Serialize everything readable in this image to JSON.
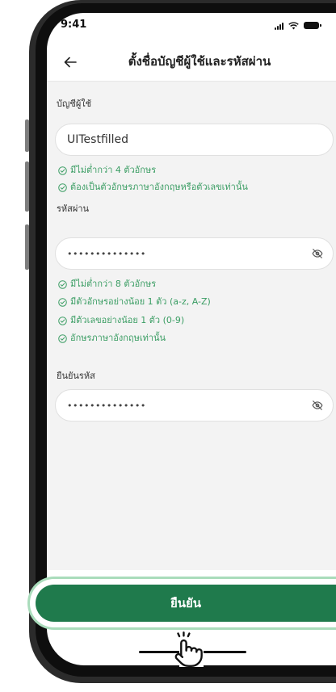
{
  "status_bar": {
    "time": "9:41",
    "icons": [
      "signal-icon",
      "wifi-icon",
      "battery-icon"
    ]
  },
  "header": {
    "back_icon": "arrow-left-icon",
    "title": "ตั้งชื่อบัญชีผู้ใช้และรหัสผ่าน"
  },
  "form": {
    "username": {
      "label": "บัญชีผู้ใช้",
      "value": "UITestfilled",
      "rules": [
        "มีไม่ต่ำกว่า 4 ตัวอักษร",
        "ต้องเป็นตัวอักษรภาษาอังกฤษหรือตัวเลขเท่านั้น"
      ]
    },
    "password": {
      "label": "รหัสผ่าน",
      "value": "••••••••••••••",
      "toggle_icon": "eye-slash-icon",
      "rules": [
        "มีไม่ต่ำกว่า 8 ตัวอักษร",
        "มีตัวอักษรอย่างน้อย 1 ตัว (a-z, A-Z)",
        "มีตัวเลขอย่างน้อย 1 ตัว (0-9)",
        "อักษรภาษาอังกฤษเท่านั้น"
      ]
    },
    "confirm": {
      "label": "ยืนยันรหัส",
      "value": "••••••••••••••",
      "toggle_icon": "eye-slash-icon"
    }
  },
  "submit_button": {
    "label": "ยืนยัน"
  },
  "rule_icon": "check-circle-icon",
  "colors": {
    "primary_green": "#1f7a4c",
    "rule_green": "#3a9d63",
    "button_halo": "#a9dcbb",
    "content_background": "#f3f3f3"
  }
}
